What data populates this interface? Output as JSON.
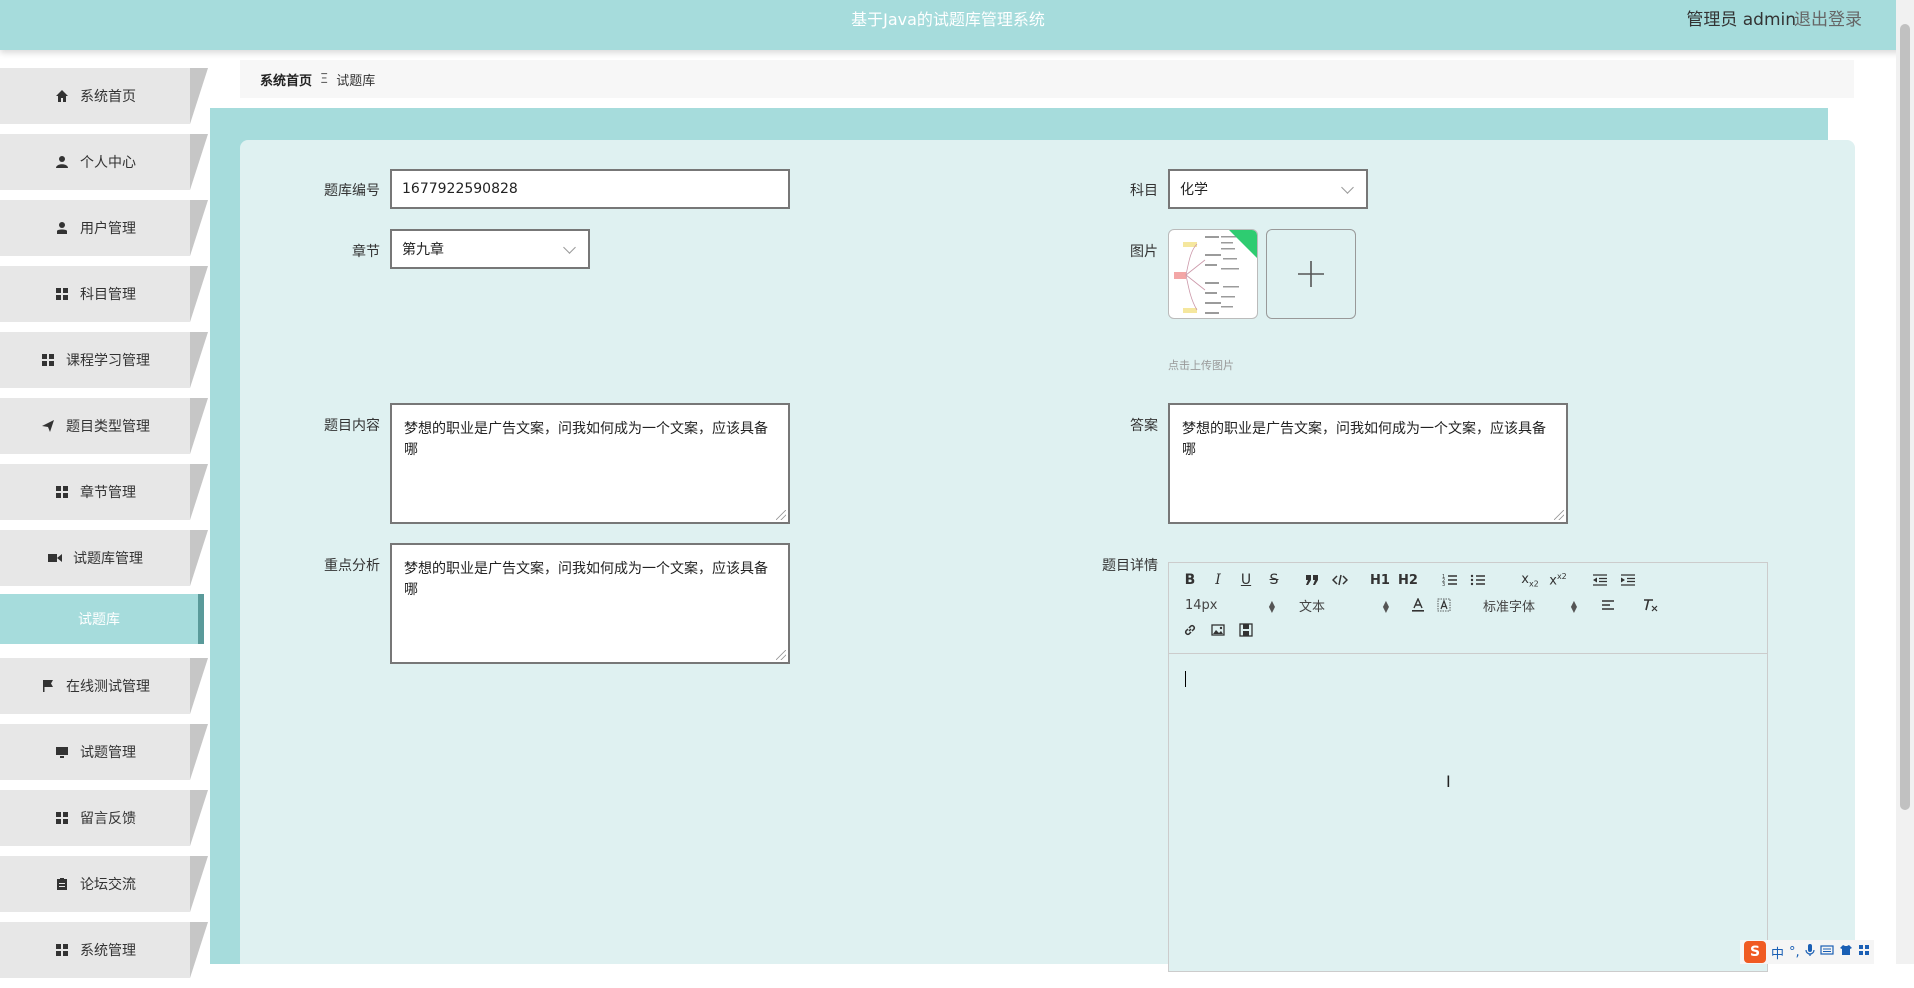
{
  "header": {
    "title": "基于Java的试题库管理系统",
    "user": "管理员 admin",
    "logout": "退出登录"
  },
  "sidebar": {
    "items": [
      {
        "label": "系统首页",
        "icon": "home-icon"
      },
      {
        "label": "个人中心",
        "icon": "user-icon"
      },
      {
        "label": "用户管理",
        "icon": "user-manage-icon"
      },
      {
        "label": "科目管理",
        "icon": "grid-icon"
      },
      {
        "label": "课程学习管理",
        "icon": "grid-icon"
      },
      {
        "label": "题目类型管理",
        "icon": "send-icon"
      },
      {
        "label": "章节管理",
        "icon": "grid-icon"
      },
      {
        "label": "试题库管理",
        "icon": "video-icon"
      },
      {
        "label": "在线测试管理",
        "icon": "flag-icon"
      },
      {
        "label": "试题管理",
        "icon": "monitor-icon"
      },
      {
        "label": "留言反馈",
        "icon": "grid-icon"
      },
      {
        "label": "论坛交流",
        "icon": "clipboard-icon"
      },
      {
        "label": "系统管理",
        "icon": "grid-icon"
      }
    ],
    "sub_item": "试题库"
  },
  "breadcrumb": {
    "home": "系统首页",
    "separator": "Ξ",
    "current": "试题库"
  },
  "form": {
    "bank_no_label": "题库编号",
    "bank_no_value": "1677922590828",
    "subject_label": "科目",
    "subject_value": "化学",
    "chapter_label": "章节",
    "chapter_value": "第九章",
    "image_label": "图片",
    "upload_tip": "点击上传图片",
    "content_label": "题目内容",
    "content_value": "梦想的职业是广告文案，问我如何成为一个文案，应该具备哪",
    "answer_label": "答案",
    "answer_value": "梦想的职业是广告文案，问我如何成为一个文案，应该具备哪",
    "analysis_label": "重点分析",
    "analysis_value": "梦想的职业是广告文案，问我如何成为一个文案，应该具备哪",
    "detail_label": "题目详情"
  },
  "editor": {
    "font_size": "14px",
    "block_type": "文本",
    "font_family": "标准字体",
    "buttons": [
      "B",
      "I",
      "U",
      "S",
      "H1",
      "H2",
      "x2",
      "x2"
    ]
  },
  "ime": {
    "lang": "中",
    "punct": "°,"
  },
  "colors": {
    "primary": "#a6dcdc",
    "panel": "#dff1f1",
    "sidebar_item": "#e7e7e7"
  }
}
